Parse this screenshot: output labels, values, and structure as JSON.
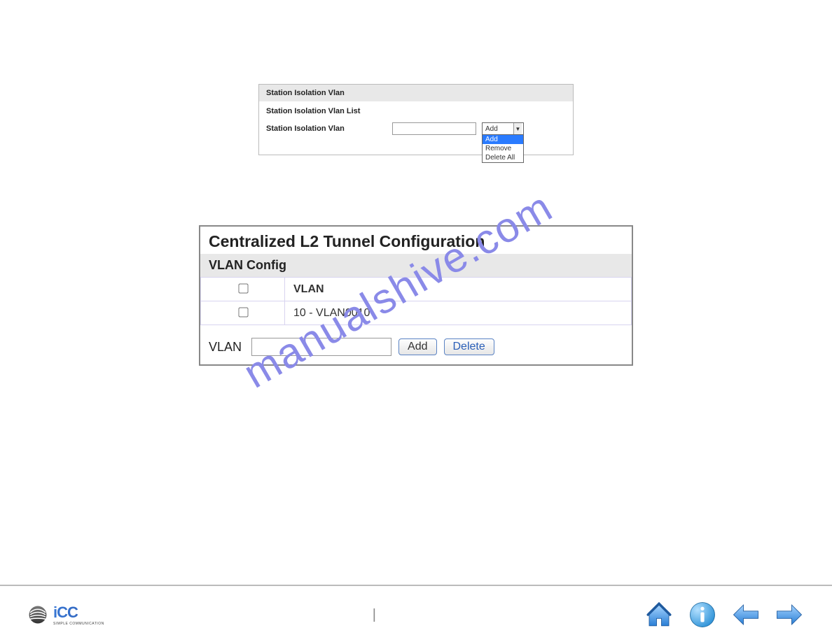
{
  "watermark": "manualshive.com",
  "panel1": {
    "title": "Station Isolation Vlan",
    "subtitle": "Station Isolation Vlan List",
    "fieldLabel": "Station Isolation Vlan",
    "inputValue": "",
    "dropdownSelected": "Add",
    "dropdownOptions": [
      "Add",
      "Remove",
      "Delete All"
    ]
  },
  "panel2": {
    "title": "Centralized L2 Tunnel Configuration",
    "subheader": "VLAN Config",
    "columns": {
      "vlan": "VLAN"
    },
    "rows": [
      {
        "checked": false,
        "vlan": "10 - VLAN0010"
      }
    ],
    "footer": {
      "label": "VLAN",
      "inputValue": "",
      "addLabel": "Add",
      "deleteLabel": "Delete"
    }
  },
  "logo": {
    "letters": "iCC",
    "sub": "SIMPLE COMMUNICATION"
  },
  "nav": {
    "home": "home-icon",
    "info": "info-icon",
    "prev": "prev-icon",
    "next": "next-icon"
  }
}
